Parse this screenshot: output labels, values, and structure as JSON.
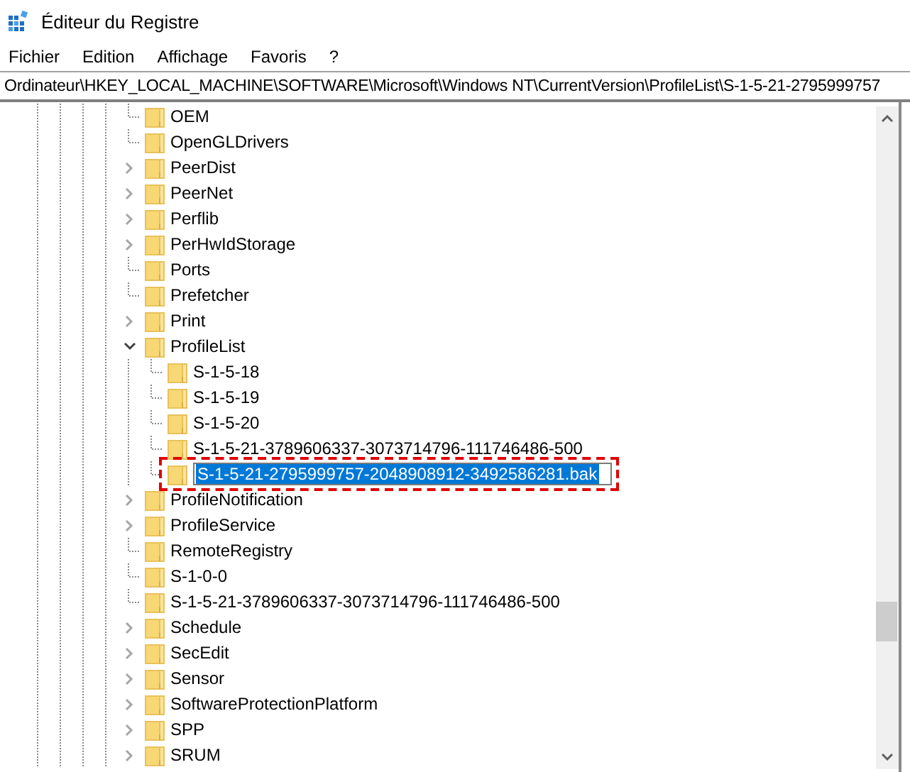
{
  "window": {
    "title": "Éditeur du Registre"
  },
  "menu": [
    "Fichier",
    "Edition",
    "Affichage",
    "Favoris",
    "?"
  ],
  "address": "Ordinateur\\HKEY_LOCAL_MACHINE\\SOFTWARE\\Microsoft\\Windows NT\\CurrentVersion\\ProfileList\\S-1-5-21-2795999757",
  "tree": [
    {
      "label": "OEM",
      "kind": "leaf"
    },
    {
      "label": "OpenGLDrivers",
      "kind": "leaf"
    },
    {
      "label": "PeerDist",
      "kind": "collapsed"
    },
    {
      "label": "PeerNet",
      "kind": "collapsed"
    },
    {
      "label": "Perflib",
      "kind": "collapsed"
    },
    {
      "label": "PerHwIdStorage",
      "kind": "collapsed"
    },
    {
      "label": "Ports",
      "kind": "leaf"
    },
    {
      "label": "Prefetcher",
      "kind": "leaf"
    },
    {
      "label": "Print",
      "kind": "collapsed"
    },
    {
      "label": "ProfileList",
      "kind": "expanded",
      "children": [
        {
          "label": "S-1-5-18",
          "kind": "leaf",
          "renaming": false
        },
        {
          "label": "S-1-5-19",
          "kind": "leaf",
          "renaming": false
        },
        {
          "label": "S-1-5-20",
          "kind": "leaf",
          "renaming": false
        },
        {
          "label": "S-1-5-21-3789606337-3073714796-111746486-500",
          "kind": "leaf",
          "renaming": false
        },
        {
          "label": "S-1-5-21-2795999757-2048908912-3492586281.bak",
          "kind": "leaf",
          "renaming": true
        }
      ]
    },
    {
      "label": "ProfileNotification",
      "kind": "collapsed"
    },
    {
      "label": "ProfileService",
      "kind": "collapsed"
    },
    {
      "label": "RemoteRegistry",
      "kind": "leaf"
    },
    {
      "label": "S-1-0-0",
      "kind": "leaf"
    },
    {
      "label": "S-1-5-21-3789606337-3073714796-111746486-500",
      "kind": "leaf"
    },
    {
      "label": "Schedule",
      "kind": "collapsed"
    },
    {
      "label": "SecEdit",
      "kind": "collapsed"
    },
    {
      "label": "Sensor",
      "kind": "collapsed"
    },
    {
      "label": "SoftwareProtectionPlatform",
      "kind": "collapsed"
    },
    {
      "label": "SPP",
      "kind": "collapsed"
    },
    {
      "label": "SRUM",
      "kind": "collapsed"
    }
  ]
}
